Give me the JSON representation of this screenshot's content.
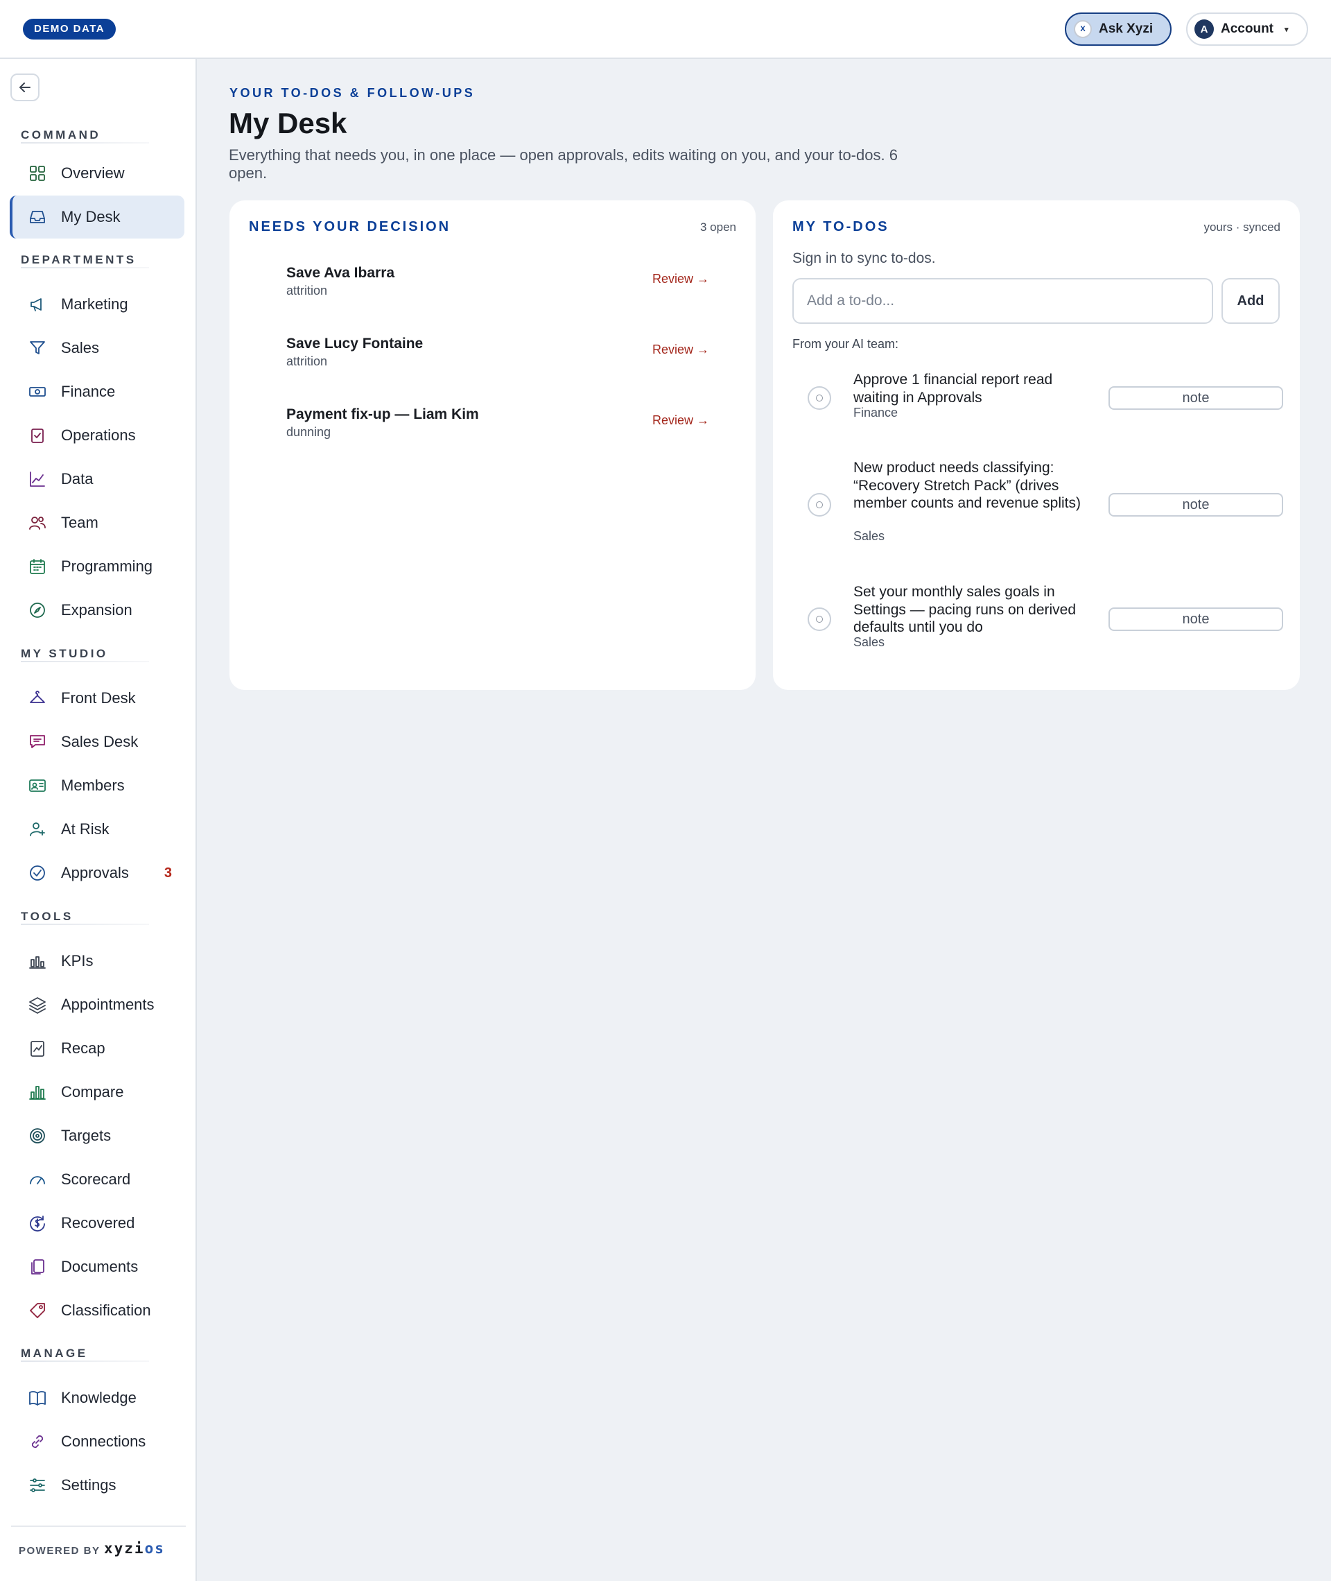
{
  "topbar": {
    "demo_badge": "DEMO DATA",
    "ask_label": "Ask Xyzi",
    "ask_icon_glyph": "X",
    "account_initial": "A",
    "account_label": "Account",
    "account_caret": "▾"
  },
  "sidebar": {
    "sections": [
      {
        "title": "COMMAND",
        "items": [
          {
            "label": "Overview",
            "icon": "grid-icon"
          },
          {
            "label": "My Desk",
            "icon": "inbox-icon",
            "active": true
          }
        ]
      },
      {
        "title": "DEPARTMENTS",
        "items": [
          {
            "label": "Marketing",
            "icon": "megaphone-icon"
          },
          {
            "label": "Sales",
            "icon": "funnel-icon"
          },
          {
            "label": "Finance",
            "icon": "banknote-icon"
          },
          {
            "label": "Operations",
            "icon": "clipboard-check-icon"
          },
          {
            "label": "Data",
            "icon": "line-chart-icon"
          },
          {
            "label": "Team",
            "icon": "users-icon"
          },
          {
            "label": "Programming",
            "icon": "calendar-icon"
          },
          {
            "label": "Expansion",
            "icon": "compass-icon"
          }
        ]
      },
      {
        "title": "MY STUDIO",
        "items": [
          {
            "label": "Front Desk",
            "icon": "hanger-icon"
          },
          {
            "label": "Sales Desk",
            "icon": "message-icon"
          },
          {
            "label": "Members",
            "icon": "id-card-icon"
          },
          {
            "label": "At Risk",
            "icon": "user-alert-icon"
          },
          {
            "label": "Approvals",
            "icon": "check-circle-icon",
            "badge": "3"
          }
        ]
      },
      {
        "title": "TOOLS",
        "items": [
          {
            "label": "KPIs",
            "icon": "bar-chart-icon"
          },
          {
            "label": "Appointments",
            "icon": "layers-icon"
          },
          {
            "label": "Recap",
            "icon": "report-icon"
          },
          {
            "label": "Compare",
            "icon": "columns-chart-icon"
          },
          {
            "label": "Targets",
            "icon": "target-icon"
          },
          {
            "label": "Scorecard",
            "icon": "gauge-icon"
          },
          {
            "label": "Recovered",
            "icon": "recover-dollar-icon"
          },
          {
            "label": "Documents",
            "icon": "files-icon"
          },
          {
            "label": "Classification",
            "icon": "tag-icon"
          }
        ]
      },
      {
        "title": "MANAGE",
        "items": [
          {
            "label": "Knowledge",
            "icon": "book-icon"
          },
          {
            "label": "Connections",
            "icon": "link-icon"
          },
          {
            "label": "Settings",
            "icon": "sliders-icon"
          }
        ]
      }
    ],
    "powered_by": "POWERED BY",
    "brand_a": "xyzi",
    "brand_b": "os"
  },
  "main": {
    "eyebrow": "YOUR TO-DOS & FOLLOW-UPS",
    "title": "My Desk",
    "subtitle": "Everything that needs you, in one place — open approvals, edits waiting on you, and your to-dos. 6 open."
  },
  "decisions": {
    "title": "NEEDS YOUR DECISION",
    "meta": "3 open",
    "items": [
      {
        "title": "Save Ava Ibarra",
        "tag": "attrition",
        "action": "Review →"
      },
      {
        "title": "Save Lucy Fontaine",
        "tag": "attrition",
        "action": "Review →"
      },
      {
        "title": "Payment fix-up — Liam Kim",
        "tag": "dunning",
        "action": "Review →"
      }
    ]
  },
  "todos": {
    "title": "MY TO-DOS",
    "meta": "yours · synced",
    "sync_note": "Sign in to sync to-dos.",
    "input_placeholder": "Add a to-do...",
    "add_label": "Add",
    "ai_label": "From your AI team:",
    "items": [
      {
        "text": "Approve 1 financial report read waiting in Approvals",
        "dept": "Finance",
        "note": "note"
      },
      {
        "text": "New product needs classifying: “Recovery Stretch Pack” (drives member counts and revenue splits)",
        "dept": "Sales",
        "note": "note"
      },
      {
        "text": "Set your monthly sales goals in Settings — pacing runs on derived defaults until you do",
        "dept": "Sales",
        "note": "note"
      }
    ]
  }
}
